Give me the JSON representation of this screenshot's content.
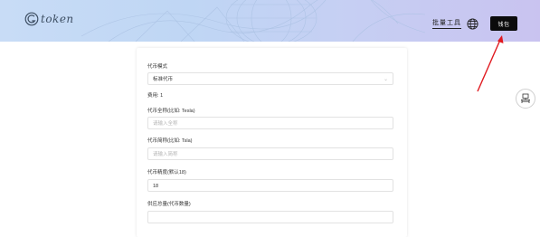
{
  "header": {
    "logo_text": "token",
    "batch_tools_label": "批量工具",
    "connect_label": "钱包"
  },
  "form": {
    "token_mode": {
      "label": "代币模式",
      "value": "标准代币"
    },
    "fee": {
      "label": "费用:",
      "value": "1"
    },
    "full_name": {
      "label": "代币全称(比如: Tesla)",
      "placeholder": "请输入全称"
    },
    "short_name": {
      "label": "代币简称(比如: Tsla)",
      "placeholder": "请输入简称"
    },
    "precision": {
      "label": "代币精度(默认18)",
      "value": "18"
    },
    "supply": {
      "label": "供应总量(代币数量)"
    }
  },
  "colors": {
    "header_gradient_start": "#c8dcf6",
    "header_gradient_end": "#c9c3f0",
    "connect_button": "#0b0b0b",
    "arrow": "#e0191f"
  },
  "icons": [
    "logo-icon",
    "globe-icon",
    "chevron-down-icon",
    "desk-icon"
  ]
}
